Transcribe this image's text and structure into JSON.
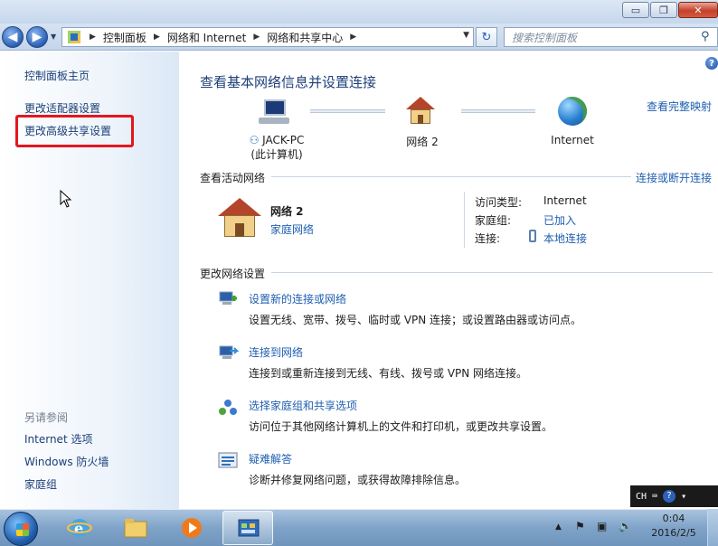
{
  "window": {
    "minimize_glyph": "▭",
    "maximize_glyph": "❐",
    "close_glyph": "✕"
  },
  "address": {
    "crumbs": [
      "控制面板",
      "网络和 Internet",
      "网络和共享中心"
    ],
    "search_placeholder": "搜索控制面板",
    "refresh_glyph": "↻"
  },
  "sidebar": {
    "items": [
      {
        "label": "控制面板主页"
      },
      {
        "label": "更改适配器设置"
      },
      {
        "label": "更改高级共享设置"
      }
    ],
    "see_also_title": "另请参阅",
    "see_also": [
      {
        "label": "Internet 选项"
      },
      {
        "label": "Windows 防火墙"
      },
      {
        "label": "家庭组"
      }
    ]
  },
  "main": {
    "title": "查看基本网络信息并设置连接",
    "full_map_link": "查看完整映射",
    "map": {
      "computer_name": "JACK-PC",
      "computer_sub": "(此计算机)",
      "network_name": "网络  2",
      "internet_label": "Internet"
    },
    "active_networks": {
      "label": "查看活动网络",
      "connect_link": "连接或断开连接",
      "network_name": "网络  2",
      "network_type": "家庭网络",
      "access_type_label": "访问类型:",
      "access_type_value": "Internet",
      "homegroup_label": "家庭组:",
      "homegroup_value": "已加入",
      "connections_label": "连接:",
      "connections_value": "本地连接"
    },
    "change_settings": {
      "label": "更改网络设置",
      "tasks": [
        {
          "title": "设置新的连接或网络",
          "desc": "设置无线、宽带、拨号、临时或 VPN 连接；或设置路由器或访问点。"
        },
        {
          "title": "连接到网络",
          "desc": "连接到或重新连接到无线、有线、拨号或 VPN 网络连接。"
        },
        {
          "title": "选择家庭组和共享选项",
          "desc": "访问位于其他网络计算机上的文件和打印机，或更改共享设置。"
        },
        {
          "title": "疑难解答",
          "desc": "诊断并修复网络问题，或获得故障排除信息。"
        }
      ]
    }
  },
  "ime": {
    "lang": "CH",
    "help": "?"
  },
  "taskbar": {
    "time": "0:04",
    "date": "2016/2/5",
    "tray_arrow": "▲"
  },
  "colors": {
    "link": "#1f5fb0",
    "title": "#1e3f7a",
    "highlight_box": "#e5161f"
  }
}
